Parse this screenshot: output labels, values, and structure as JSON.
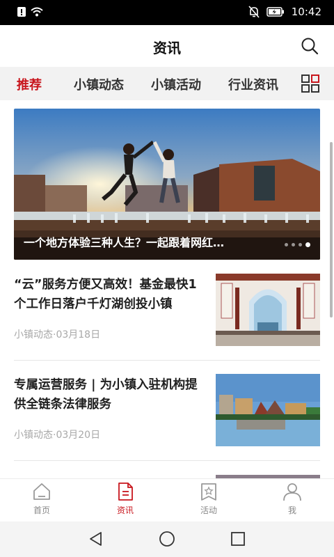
{
  "status_bar": {
    "time": "10:42",
    "icons": [
      "alert-icon",
      "wifi-icon",
      "mute-bell-icon",
      "battery-charging-icon"
    ]
  },
  "header": {
    "title": "资讯",
    "search_icon": "search-icon"
  },
  "tabs": [
    {
      "label": "推荐",
      "active": true
    },
    {
      "label": "小镇动态",
      "active": false
    },
    {
      "label": "小镇活动",
      "active": false
    },
    {
      "label": "行业资讯",
      "active": false
    }
  ],
  "tab_menu_icon": "grid-menu-icon",
  "banner": {
    "caption": "一个地方体验三种人生？一起跟着网红…",
    "slide_count": 4,
    "active_slide": 4
  },
  "news": [
    {
      "headline": "“云”服务方便又高效！基金最快1个工作日落户千灯湖创投小镇",
      "meta": "小镇动态·03月18日"
    },
    {
      "headline": "专属运营服务 | 为小镇入驻机构提供全链条法律服务",
      "meta": "小镇动态·03月20日"
    }
  ],
  "bottom_nav": [
    {
      "label": "首页",
      "icon": "home-icon",
      "active": false
    },
    {
      "label": "资讯",
      "icon": "news-document-icon",
      "active": true
    },
    {
      "label": "活动",
      "icon": "event-ticket-icon",
      "active": false
    },
    {
      "label": "我",
      "icon": "person-icon",
      "active": false
    }
  ],
  "colors": {
    "accent": "#c8161d",
    "status_bar_bg": "#000000",
    "tab_bar_bg": "#f2f2f2",
    "meta_text": "#a8a8a8"
  }
}
